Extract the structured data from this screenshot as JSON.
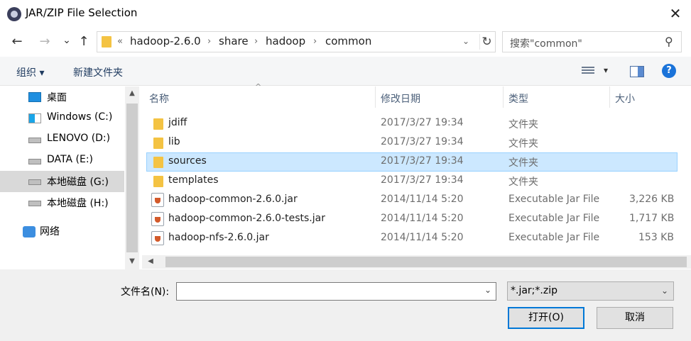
{
  "window": {
    "title": "JAR/ZIP File Selection",
    "close_glyph": "✕"
  },
  "nav_buttons": {
    "back": "←",
    "forward": "→",
    "dropdown": "⌄",
    "up": "↑"
  },
  "address": {
    "overflow": "«",
    "crumbs": [
      "hadoop-2.6.0",
      "share",
      "hadoop",
      "common"
    ],
    "sep": "›",
    "refresh_glyph": "↻"
  },
  "search": {
    "placeholder": "搜索\"common\"",
    "icon": "⚲"
  },
  "toolbar": {
    "organize": "组织 ▾",
    "new_folder": "新建文件夹",
    "view_dropdown": "▾",
    "help": "?"
  },
  "sidebar": {
    "items": [
      {
        "label": "桌面",
        "icon": "desktop-icon"
      },
      {
        "label": "Windows (C:)",
        "icon": "windows-drive-icon"
      },
      {
        "label": "LENOVO (D:)",
        "icon": "drive-icon"
      },
      {
        "label": "DATA (E:)",
        "icon": "drive-icon"
      },
      {
        "label": "本地磁盘 (G:)",
        "icon": "drive-icon",
        "selected": true
      },
      {
        "label": "本地磁盘 (H:)",
        "icon": "drive-icon"
      },
      {
        "label": "网络",
        "icon": "network-icon"
      }
    ],
    "scroll_up": "▲",
    "scroll_down": "▼"
  },
  "columns": {
    "name": "名称",
    "modified": "修改日期",
    "type": "类型",
    "size": "大小",
    "sort_glyph": "^"
  },
  "files": [
    {
      "name": "jdiff",
      "modified": "2017/3/27 19:34",
      "type": "文件夹",
      "size": "",
      "kind": "folder"
    },
    {
      "name": "lib",
      "modified": "2017/3/27 19:34",
      "type": "文件夹",
      "size": "",
      "kind": "folder"
    },
    {
      "name": "sources",
      "modified": "2017/3/27 19:34",
      "type": "文件夹",
      "size": "",
      "kind": "folder",
      "selected": true
    },
    {
      "name": "templates",
      "modified": "2017/3/27 19:34",
      "type": "文件夹",
      "size": "",
      "kind": "folder"
    },
    {
      "name": "hadoop-common-2.6.0.jar",
      "modified": "2014/11/14 5:20",
      "type": "Executable Jar File",
      "size": "3,226 KB",
      "kind": "jar"
    },
    {
      "name": "hadoop-common-2.6.0-tests.jar",
      "modified": "2014/11/14 5:20",
      "type": "Executable Jar File",
      "size": "1,717 KB",
      "kind": "jar"
    },
    {
      "name": "hadoop-nfs-2.6.0.jar",
      "modified": "2014/11/14 5:20",
      "type": "Executable Jar File",
      "size": "153 KB",
      "kind": "jar"
    }
  ],
  "hscroll": {
    "left": "◀",
    "right": "▶"
  },
  "bottom": {
    "filename_label": "文件名(N):",
    "filename_value": "",
    "filename_chevron": "⌄",
    "filter_value": "*.jar;*.zip",
    "filter_chevron": "⌄",
    "open_button": "打开(O)",
    "cancel_button": "取消"
  }
}
